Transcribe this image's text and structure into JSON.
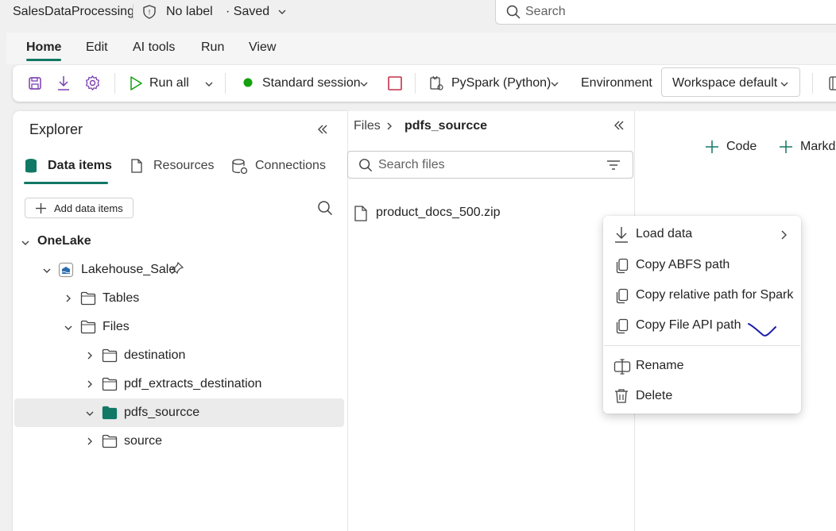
{
  "titlebar": {
    "app_title": "SalesDataProcessing",
    "label_status": "No label",
    "save_status": "· Saved",
    "search_placeholder": "Search"
  },
  "ribbon": {
    "tabs": [
      "Home",
      "Edit",
      "AI tools",
      "Run",
      "View"
    ]
  },
  "toolbar": {
    "run_all": "Run all",
    "session": "Standard session",
    "language": "PySpark (Python)",
    "environment_label": "Environment",
    "workspace": "Workspace default"
  },
  "explorer": {
    "title": "Explorer",
    "tabs": [
      "Data items",
      "Resources",
      "Connections"
    ],
    "add_button": "Add data items",
    "tree": {
      "onelake": "OneLake",
      "lakehouse": "Lakehouse_Sale",
      "tables": "Tables",
      "files": "Files",
      "folders": [
        "destination",
        "pdf_extracts_destination",
        "pdfs_sourcce",
        "source"
      ]
    }
  },
  "files_panel": {
    "breadcrumb_root": "Files",
    "breadcrumb_current": "pdfs_sourcce",
    "search_placeholder": "Search files",
    "files": [
      "product_docs_500.zip"
    ]
  },
  "editor": {
    "add_code": "Code",
    "add_markdown": "Markd"
  },
  "context_menu": {
    "items": [
      "Load data",
      "Copy ABFS path",
      "Copy relative path for Spark",
      "Copy File API path",
      "Rename",
      "Delete"
    ]
  },
  "colors": {
    "accent": "#117865",
    "session_green": "#13a10e",
    "purple_icon": "#7a3fb0",
    "stop_red": "#c4314b",
    "annotation_blue": "#1a1aa8"
  }
}
